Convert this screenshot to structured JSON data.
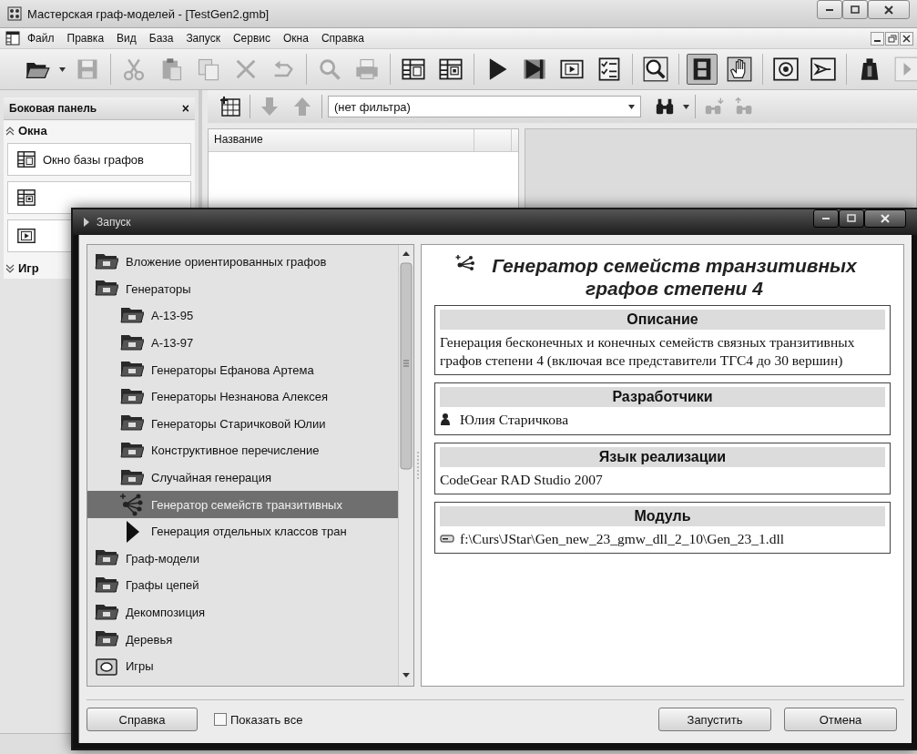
{
  "window": {
    "title": "Мастерская граф-моделей - [TestGen2.gmb]"
  },
  "menu": [
    "Файл",
    "Правка",
    "Вид",
    "База",
    "Запуск",
    "Сервис",
    "Окна",
    "Справка"
  ],
  "toolbar": [
    [
      {
        "kind": "open",
        "disabled": false,
        "pressed": false
      },
      {
        "kind": "save",
        "disabled": true,
        "pressed": false
      }
    ],
    [
      {
        "kind": "cut",
        "disabled": true,
        "pressed": false
      },
      {
        "kind": "paste",
        "disabled": true,
        "pressed": false
      },
      {
        "kind": "copy",
        "disabled": true,
        "pressed": false
      },
      {
        "kind": "delete",
        "disabled": true,
        "pressed": false
      },
      {
        "kind": "undo",
        "disabled": true,
        "pressed": false
      }
    ],
    [
      {
        "kind": "find",
        "disabled": true,
        "pressed": false
      },
      {
        "kind": "print",
        "disabled": true,
        "pressed": false
      }
    ],
    [
      {
        "kind": "table",
        "disabled": false,
        "pressed": false
      },
      {
        "kind": "panel",
        "disabled": false,
        "pressed": false
      }
    ],
    [
      {
        "kind": "run",
        "disabled": false,
        "pressed": false
      },
      {
        "kind": "step",
        "disabled": false,
        "pressed": false
      },
      {
        "kind": "frame",
        "disabled": false,
        "pressed": false
      },
      {
        "kind": "checklist",
        "disabled": false,
        "pressed": false
      }
    ],
    [
      {
        "kind": "zoom",
        "disabled": false,
        "pressed": false
      }
    ],
    [
      {
        "kind": "film",
        "disabled": false,
        "pressed": true
      },
      {
        "kind": "hand",
        "disabled": false,
        "pressed": false
      }
    ],
    [
      {
        "kind": "target",
        "disabled": false,
        "pressed": false
      },
      {
        "kind": "send",
        "disabled": false,
        "pressed": false
      }
    ],
    [
      {
        "kind": "weight",
        "disabled": false,
        "pressed": false
      },
      {
        "kind": "play",
        "disabled": true,
        "pressed": false
      }
    ]
  ],
  "sidebar": {
    "title": "Боковая панель",
    "close": "×",
    "groups": [
      {
        "label": "Окна",
        "expanded": true,
        "items": [
          {
            "kind": "table",
            "label": "Окно базы графов"
          },
          {
            "kind": "panel"
          },
          {
            "kind": "frame"
          }
        ]
      },
      {
        "label": "Игр",
        "expanded": false
      }
    ]
  },
  "filter_bar": {
    "tools": [
      {
        "kind": "add-table",
        "disabled": false
      },
      {
        "kind": "down",
        "disabled": true
      },
      {
        "kind": "up",
        "disabled": true
      }
    ],
    "filter": "(нет фильтра)",
    "search_tools": [
      {
        "kind": "binoculars",
        "disabled": false
      },
      {
        "kind": "binoculars-down",
        "disabled": true
      },
      {
        "kind": "binoculars-up",
        "disabled": true
      }
    ]
  },
  "table": {
    "columns": [
      "Название"
    ]
  },
  "dialog": {
    "title": "Запуск",
    "tree": [
      {
        "kind": "folder",
        "label": "Вложение ориентированных графов",
        "selected": false
      },
      {
        "kind": "folder",
        "label": "Генераторы",
        "selected": false,
        "children": [
          {
            "kind": "folder",
            "label": "A-13-95",
            "selected": false
          },
          {
            "kind": "folder",
            "label": "A-13-97",
            "selected": false
          },
          {
            "kind": "folder",
            "label": "Генераторы Ефанова Артема",
            "selected": false
          },
          {
            "kind": "folder",
            "label": "Генераторы Незнанова Алексея",
            "selected": false
          },
          {
            "kind": "folder",
            "label": "Генераторы Старичковой Юлии",
            "selected": false
          },
          {
            "kind": "folder",
            "label": "Конструктивное перечисление",
            "selected": false
          },
          {
            "kind": "folder",
            "label": "Случайная генерация",
            "selected": false
          },
          {
            "kind": "generator",
            "label": "Генератор семейств транзитивных",
            "selected": true
          },
          {
            "kind": "run",
            "label": "Генерация отдельных классов тран",
            "selected": false
          }
        ]
      },
      {
        "kind": "folder",
        "label": "Граф-модели",
        "selected": false
      },
      {
        "kind": "folder",
        "label": "Графы цепей",
        "selected": false
      },
      {
        "kind": "folder",
        "label": "Декомпозиция",
        "selected": false
      },
      {
        "kind": "folder",
        "label": "Деревья",
        "selected": false
      },
      {
        "kind": "games",
        "label": "Игры",
        "selected": false
      }
    ],
    "details": {
      "title": "Генератор семейств транзитивных графов степени 4",
      "sections": [
        {
          "heading": "Описание",
          "kind": "text",
          "text": "Генерация бесконечных и конечных семейств связных транзитивных графов степени 4 (включая все представители ТГС4 до 30 вершин)"
        },
        {
          "heading": "Разработчики",
          "kind": "person",
          "text": "Юлия Старичкова"
        },
        {
          "heading": "Язык реализации",
          "kind": "text",
          "text": "CodeGear RAD Studio 2007"
        },
        {
          "heading": "Модуль",
          "kind": "file",
          "text": "f:\\Curs\\JStar\\Gen_new_23_gmw_dll_2_10\\Gen_23_1.dll"
        }
      ]
    },
    "help_button": "Справка",
    "show_all": {
      "label": "Показать все",
      "checked": false
    },
    "buttons": [
      "Запустить",
      "Отмена"
    ]
  }
}
